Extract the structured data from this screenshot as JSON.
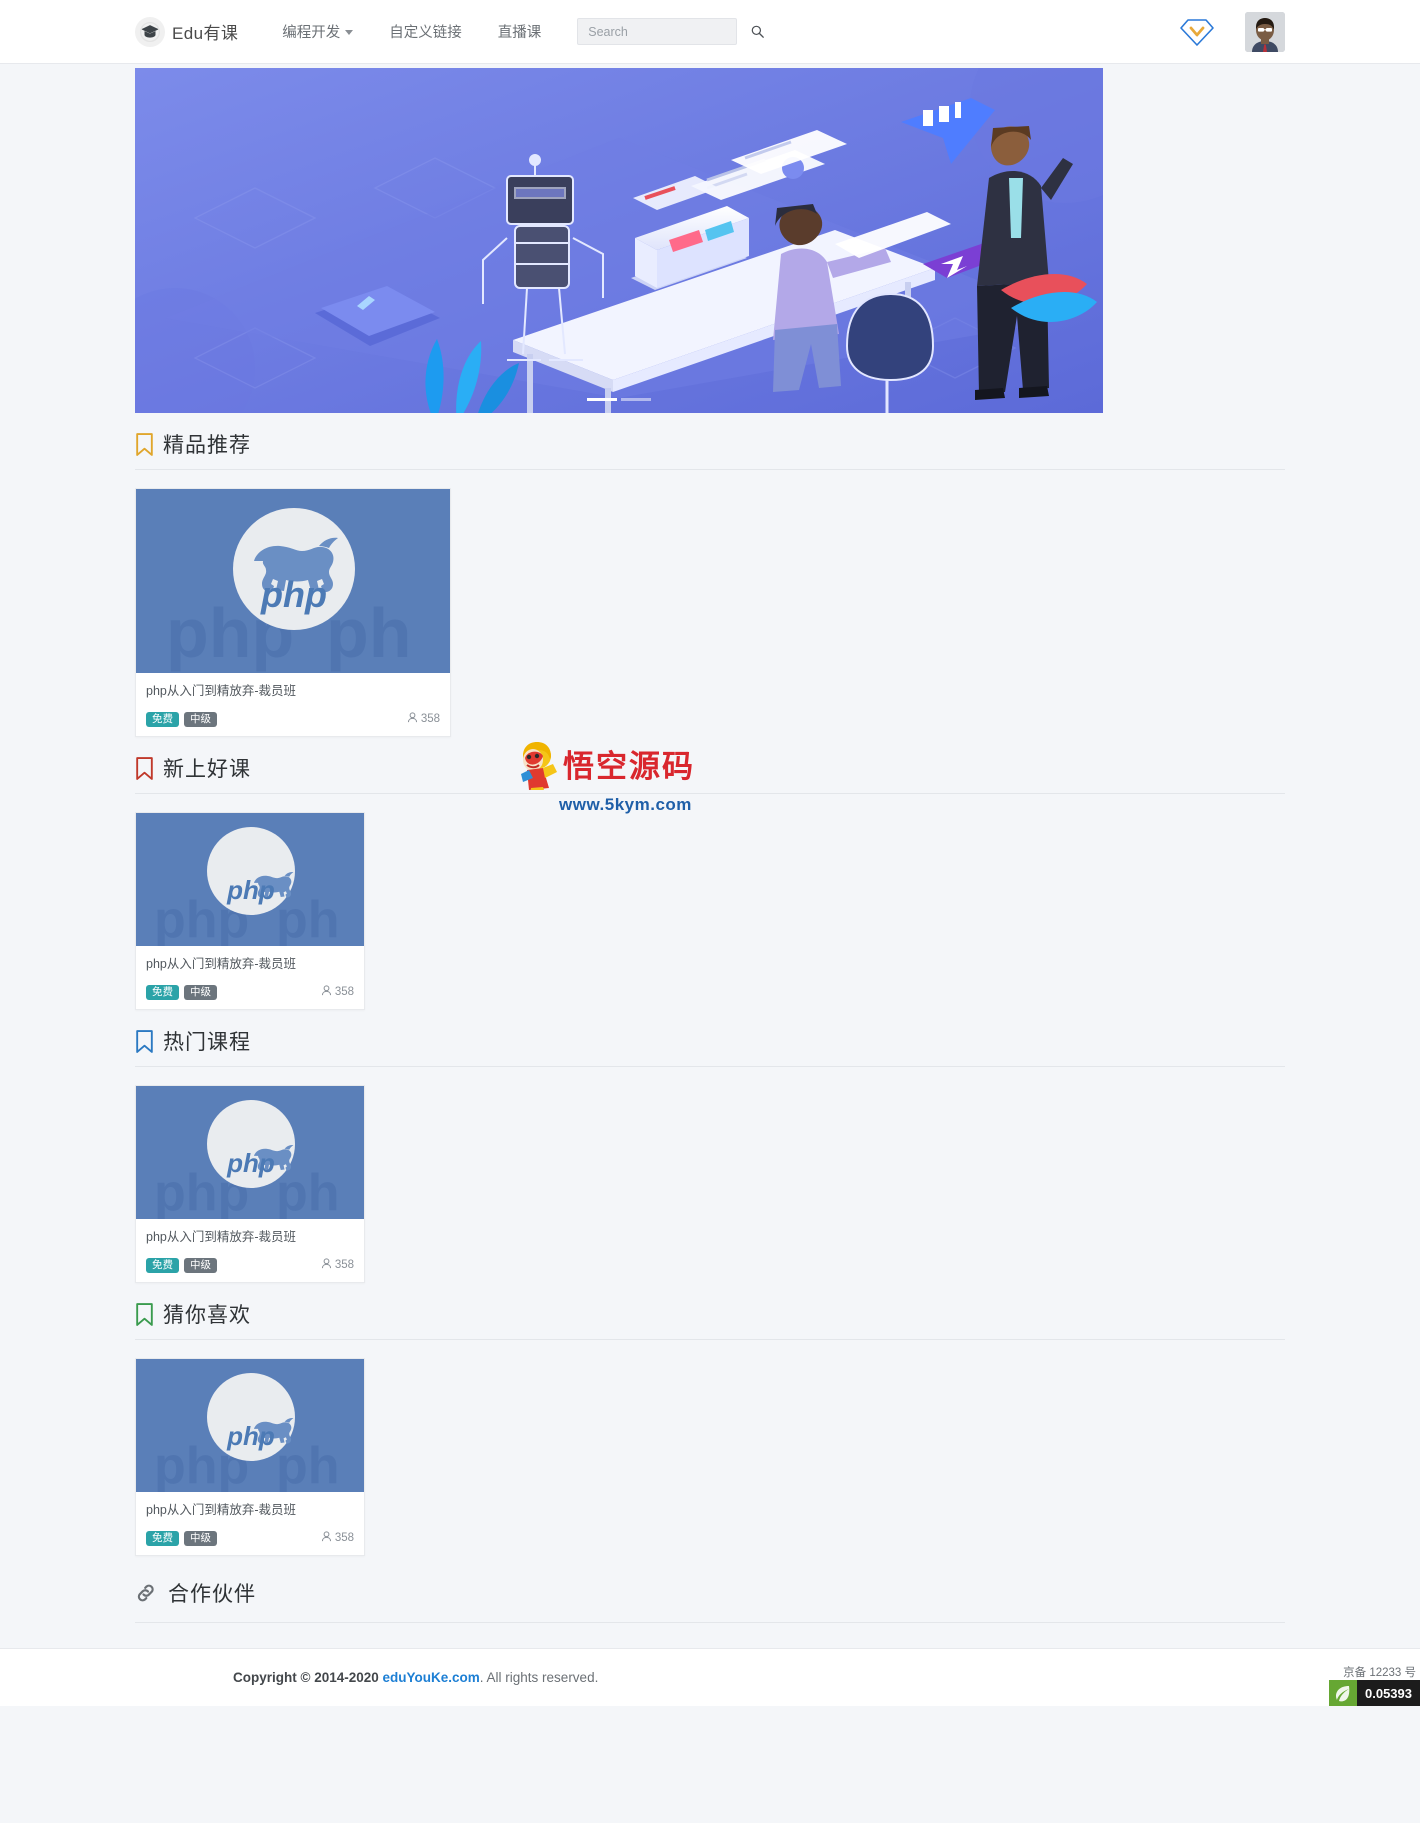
{
  "navbar": {
    "brand": "Edu有课",
    "brand_icon": "graduation-cap-icon",
    "links": [
      {
        "label": "编程开发",
        "has_dropdown": true
      },
      {
        "label": "自定义链接",
        "has_dropdown": false
      },
      {
        "label": "直播课",
        "has_dropdown": false
      }
    ],
    "search": {
      "placeholder": "Search",
      "value": "",
      "icon": "search-icon"
    },
    "vip_icon": "vip-diamond-icon",
    "avatar_icon": "user-avatar"
  },
  "carousel": {
    "alt": "isometric illustration of robot, developer at desk and presenter",
    "slides": 2,
    "active_index": 0
  },
  "sections": [
    {
      "id": "featured",
      "title": "精品推荐",
      "icon": "bookmark-icon",
      "icon_color": "#e0a62c",
      "card_size": "big",
      "courses": [
        {
          "title": "php从入门到精放弃-裁员班",
          "thumb_alt": "php elephant logo",
          "badge_free": "免费",
          "badge_level": "中级",
          "views": "358",
          "views_icon": "user-icon"
        }
      ]
    },
    {
      "id": "newest",
      "title": "新上好课",
      "icon": "bookmark-icon",
      "icon_color": "#c0392b",
      "card_size": "small",
      "courses": [
        {
          "title": "php从入门到精放弃-裁员班",
          "thumb_alt": "php elephant logo",
          "badge_free": "免费",
          "badge_level": "中级",
          "views": "358",
          "views_icon": "user-icon"
        }
      ]
    },
    {
      "id": "hot",
      "title": "热门课程",
      "icon": "bookmark-icon",
      "icon_color": "#2b79c2",
      "card_size": "small",
      "courses": [
        {
          "title": "php从入门到精放弃-裁员班",
          "thumb_alt": "php elephant logo",
          "badge_free": "免费",
          "badge_level": "中级",
          "views": "358",
          "views_icon": "user-icon"
        }
      ]
    },
    {
      "id": "guess",
      "title": "猜你喜欢",
      "icon": "bookmark-icon",
      "icon_color": "#3a9b4e",
      "card_size": "small",
      "courses": [
        {
          "title": "php从入门到精放弃-裁员班",
          "thumb_alt": "php elephant logo",
          "badge_free": "免费",
          "badge_level": "中级",
          "views": "358",
          "views_icon": "user-icon"
        }
      ]
    }
  ],
  "partners": {
    "title": "合作伙伴",
    "icon": "link-chain-icon"
  },
  "watermark": {
    "text": "悟空源码",
    "url": "www.5kym.com",
    "icon": "monkey-king-icon"
  },
  "footer": {
    "copyright_prefix": "Copyright © 2014-2020 ",
    "site_link": "eduYouKe.com",
    "copyright_suffix": ". All rights reserved.",
    "icp": "京备 12233 号"
  },
  "debug": {
    "leaf_icon": "leaf-icon",
    "render_time": "0.05393"
  },
  "colors": {
    "accent": "#1d7fd4",
    "badge_free": "#2ba3a8",
    "badge_level": "#6c757d",
    "page_bg": "#f4f6f9"
  }
}
